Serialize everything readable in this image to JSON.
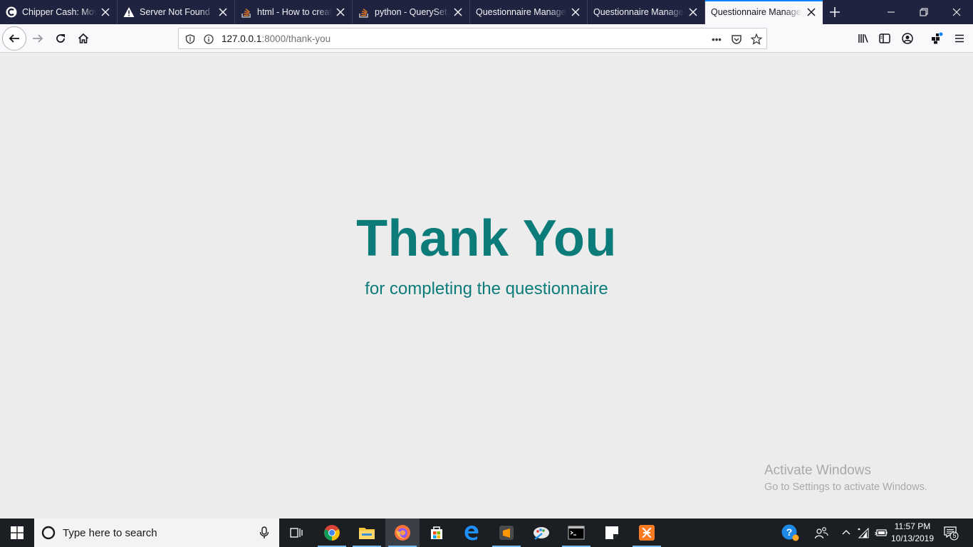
{
  "browser": {
    "tabs": [
      {
        "title": "Chipper Cash: Move",
        "icon": "chipper-icon",
        "active": false
      },
      {
        "title": "Server Not Found",
        "icon": "warning-icon",
        "active": false
      },
      {
        "title": "html - How to creat",
        "icon": "stackoverflow-icon",
        "active": false
      },
      {
        "title": "python - QuerySet, ",
        "icon": "stackoverflow-icon",
        "active": false
      },
      {
        "title": "Questionnaire Managem",
        "icon": "none",
        "active": false
      },
      {
        "title": "Questionnaire Managem",
        "icon": "none",
        "active": false
      },
      {
        "title": "Questionnaire Managem",
        "icon": "none",
        "active": true
      }
    ],
    "url_host": "127.0.0.1",
    "url_rest": ":8000/thank-you",
    "page_actions_label": "•••"
  },
  "page": {
    "title": "Thank You",
    "subtitle": "for completing the questionnaire"
  },
  "watermark": {
    "line1": "Activate Windows",
    "line2": "Go to Settings to activate Windows."
  },
  "taskbar": {
    "search_placeholder": "Type here to search",
    "apps": [
      "task-view",
      "chrome",
      "file-explorer",
      "firefox",
      "microsoft-store",
      "edge",
      "sublime-text",
      "paint",
      "command-prompt",
      "sticky-notes",
      "xampp"
    ],
    "clock_time": "11:57 PM",
    "clock_date": "10/13/2019",
    "notification_count": "5"
  },
  "colors": {
    "accent": "#0b7c7a",
    "titlebar": "#202340",
    "tab_highlight": "#0a84ff",
    "taskbar": "#1b1f24"
  }
}
